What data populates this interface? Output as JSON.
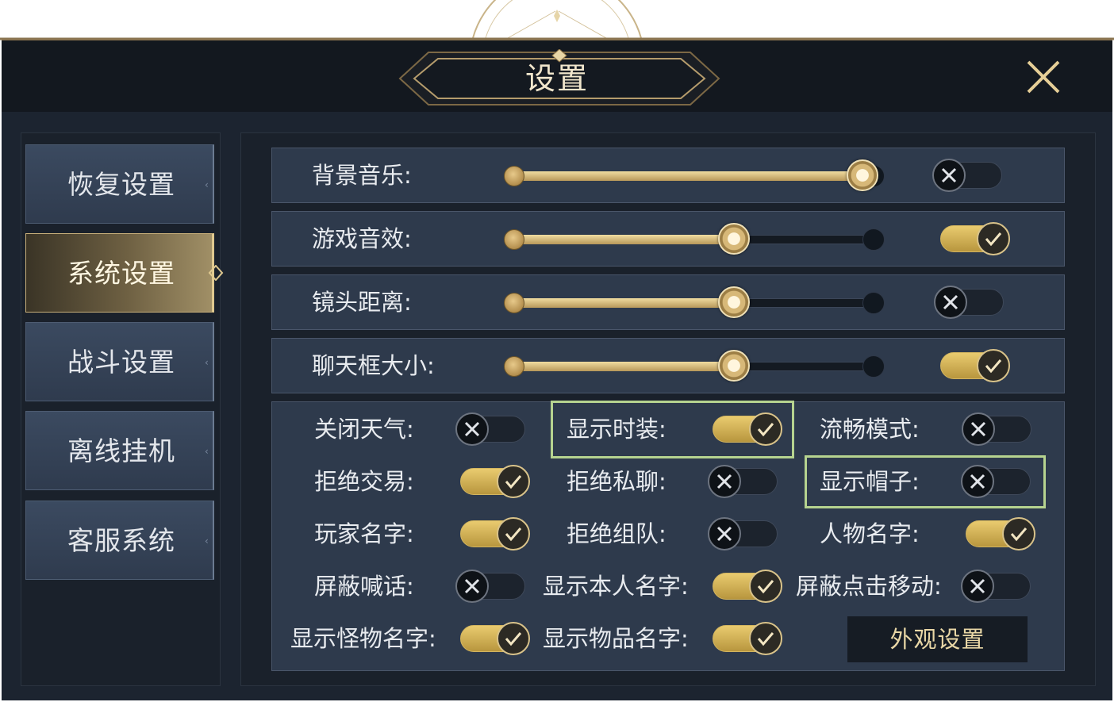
{
  "window": {
    "title": "设置",
    "close_icon": "close-icon"
  },
  "sidebar": {
    "items": [
      {
        "label": "恢复设置",
        "active": false
      },
      {
        "label": "系统设置",
        "active": true
      },
      {
        "label": "战斗设置",
        "active": false
      },
      {
        "label": "离线挂机",
        "active": false
      },
      {
        "label": "客服系统",
        "active": false
      }
    ]
  },
  "sliders": [
    {
      "label": "背景音乐:",
      "value_fraction": 1.0,
      "enabled": false
    },
    {
      "label": "游戏音效:",
      "value_fraction": 0.63,
      "enabled": true
    },
    {
      "label": "镜头距离:",
      "value_fraction": 0.63,
      "enabled": false
    },
    {
      "label": "聊天框大小:",
      "value_fraction": 0.63,
      "enabled": true
    }
  ],
  "options": [
    {
      "label": "关闭天气:",
      "on": false
    },
    {
      "label": "显示时装:",
      "on": true
    },
    {
      "label": "流畅模式:",
      "on": false
    },
    {
      "label": "拒绝交易:",
      "on": true
    },
    {
      "label": "拒绝私聊:",
      "on": false
    },
    {
      "label": "显示帽子:",
      "on": false
    },
    {
      "label": "玩家名字:",
      "on": true
    },
    {
      "label": "拒绝组队:",
      "on": false
    },
    {
      "label": "人物名字:",
      "on": true
    },
    {
      "label": "屏蔽喊话:",
      "on": false
    },
    {
      "label": "显示本人名字:",
      "on": true
    },
    {
      "label": "屏蔽点击移动:",
      "on": false
    },
    {
      "label": "显示怪物名字:",
      "on": true
    },
    {
      "label": "显示物品名字:",
      "on": true
    }
  ],
  "appearance_button": {
    "label": "外观设置"
  },
  "colors": {
    "gold": "#d9bb6a",
    "highlight": "#b6d38f",
    "panel": "#2e3a4c"
  }
}
